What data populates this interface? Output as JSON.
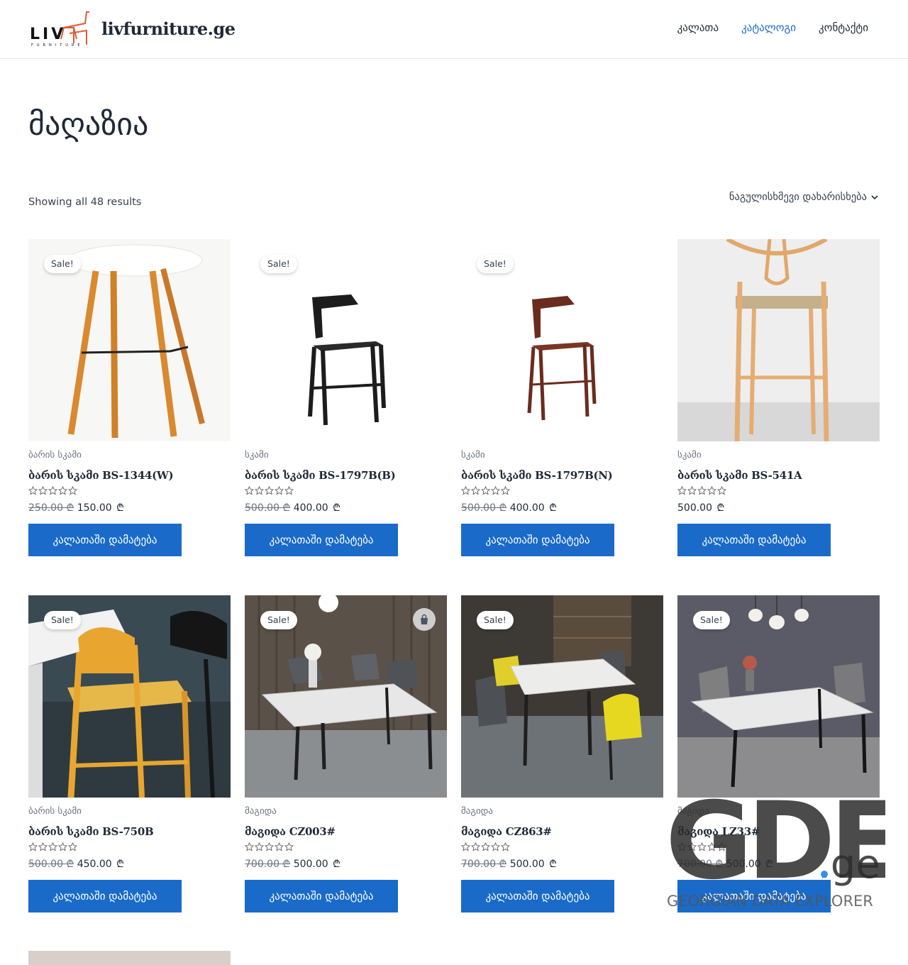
{
  "header": {
    "logo_text": "LIV",
    "logo_sub": "FURNITURE",
    "site_title": "livfurniture.ge",
    "nav": [
      {
        "label": "კალათა",
        "active": false
      },
      {
        "label": "კატალოგი",
        "active": true
      },
      {
        "label": "კონტაქტი",
        "active": false
      }
    ]
  },
  "page": {
    "title": "მაღაზია",
    "result_count": "Showing all 48 results",
    "ordering": "ნაგულისხმევი დახარისხება"
  },
  "colors": {
    "accent": "#1a6bc9",
    "text": "#1f2937",
    "muted": "#6b7280"
  },
  "products": [
    {
      "sale": "Sale!",
      "category": "ბარის სკამი",
      "name": "ბარის სკამი BS-1344(W)",
      "old_price": "250.00",
      "price": "150.00",
      "currency": "₾",
      "button": "კალათაში დამატება",
      "image": "wooden-bar-stool"
    },
    {
      "sale": "Sale!",
      "category": "სკამი",
      "name": "ბარის სკამი BS-1797B(B)",
      "old_price": "500.00",
      "price": "400.00",
      "currency": "₾",
      "button": "კალათაში დამატება",
      "image": "black-bar-stool"
    },
    {
      "sale": "Sale!",
      "category": "სკამი",
      "name": "ბარის სკამი BS-1797B(N)",
      "old_price": "500.00",
      "price": "400.00",
      "currency": "₾",
      "button": "კალათაში დამატება",
      "image": "walnut-bar-stool"
    },
    {
      "sale": "",
      "category": "სკამი",
      "name": "ბარის სკამი BS-541A",
      "old_price": "",
      "price": "500.00",
      "currency": "₾",
      "button": "კალათაში დამატება",
      "image": "wishbone-bar-stool"
    },
    {
      "sale": "Sale!",
      "category": "ბარის სკამი",
      "name": "ბარის სკამი BS-750B",
      "old_price": "500.00",
      "price": "450.00",
      "currency": "₾",
      "button": "კალათაში დამატება",
      "image": "rush-seat-bar-stool"
    },
    {
      "sale": "Sale!",
      "category": "მაგიდა",
      "name": "მაგიდა CZ003#",
      "old_price": "700.00",
      "price": "500.00",
      "currency": "₾",
      "button": "კალათაში დამატება",
      "image": "marble-dining-table",
      "quick_view": "bag-icon"
    },
    {
      "sale": "Sale!",
      "category": "მაგიდა",
      "name": "მაგიდა CZ863#",
      "old_price": "700.00",
      "price": "500.00",
      "currency": "₾",
      "button": "კალათაში დამატება",
      "image": "dining-table-yellow-chair"
    },
    {
      "sale": "Sale!",
      "category": "მაგიდა",
      "name": "მაგიდა LZ33#",
      "old_price": "700.00",
      "price": "500.00",
      "currency": "₾",
      "button": "კალათაში დამატება",
      "image": "dining-table-pendant-lamps"
    }
  ],
  "watermark": {
    "brand": "GDE",
    "domain": ".ge",
    "tagline": "GEORGIAN DATA EXPLORER"
  }
}
